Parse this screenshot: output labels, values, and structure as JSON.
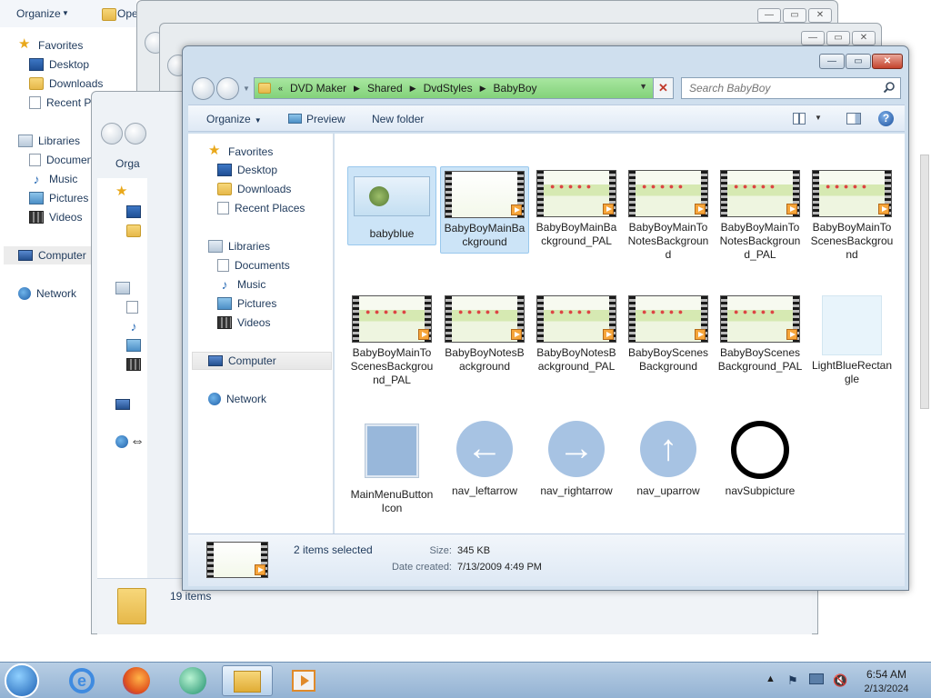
{
  "back_window": {
    "toolbar": {
      "organize": "Organize",
      "open": "Ope"
    },
    "nav": [
      {
        "label": "Favorites",
        "icon": "star-icon"
      },
      {
        "label": "Desktop",
        "icon": "desktop-icon"
      },
      {
        "label": "Downloads",
        "icon": "folder-icon"
      },
      {
        "label": "Recent Pl",
        "icon": "recent-places-icon"
      },
      {
        "label": "Libraries",
        "icon": "libraries-icon"
      },
      {
        "label": "Documen",
        "icon": "documents-icon"
      },
      {
        "label": "Music",
        "icon": "music-icon"
      },
      {
        "label": "Pictures",
        "icon": "pictures-icon"
      },
      {
        "label": "Videos",
        "icon": "videos-icon"
      },
      {
        "label": "Computer",
        "icon": "computer-icon"
      },
      {
        "label": "Network",
        "icon": "network-icon"
      }
    ],
    "middle_toolbar": {
      "organize": "Orga"
    },
    "status": "19 items"
  },
  "main_window": {
    "breadcrumbs": [
      "DVD Maker",
      "Shared",
      "DvdStyles",
      "BabyBoy"
    ],
    "search_placeholder": "Search BabyBoy",
    "toolbar": {
      "organize": "Organize",
      "preview": "Preview",
      "new_folder": "New folder"
    },
    "nav": {
      "favorites": "Favorites",
      "desktop": "Desktop",
      "downloads": "Downloads",
      "recent_places": "Recent Places",
      "libraries": "Libraries",
      "documents": "Documents",
      "music": "Music",
      "pictures": "Pictures",
      "videos": "Videos",
      "computer": "Computer",
      "network": "Network"
    },
    "files": [
      {
        "name": "babyblue",
        "kind": "image-babyblue",
        "selected": true
      },
      {
        "name": "BabyBoyMainBackground",
        "kind": "video-blank",
        "selected": true
      },
      {
        "name": "BabyBoyMainBackground_PAL",
        "kind": "video"
      },
      {
        "name": "BabyBoyMainToNotesBackground",
        "kind": "video"
      },
      {
        "name": "BabyBoyMainToNotesBackground_PAL",
        "kind": "video"
      },
      {
        "name": "BabyBoyMainToScenesBackground",
        "kind": "video"
      },
      {
        "name": "BabyBoyMainToScenesBackground_PAL",
        "kind": "video"
      },
      {
        "name": "BabyBoyNotesBackground",
        "kind": "video"
      },
      {
        "name": "BabyBoyNotesBackground_PAL",
        "kind": "video"
      },
      {
        "name": "BabyBoyScenesBackground",
        "kind": "video"
      },
      {
        "name": "BabyBoyScenesBackground_PAL",
        "kind": "video"
      },
      {
        "name": "LightBlueRectangle",
        "kind": "image-lightblue"
      },
      {
        "name": "MainMenuButtonIcon",
        "kind": "image-bluesquare"
      },
      {
        "name": "nav_leftarrow",
        "kind": "image-arrow",
        "glyph": "←"
      },
      {
        "name": "nav_rightarrow",
        "kind": "image-arrow",
        "glyph": "→"
      },
      {
        "name": "nav_uparrow",
        "kind": "image-arrow",
        "glyph": "↑"
      },
      {
        "name": "navSubpicture",
        "kind": "image-ring"
      }
    ],
    "details": {
      "selection": "2 items selected",
      "size_label": "Size:",
      "size_value": "345 KB",
      "date_label": "Date created:",
      "date_value": "7/13/2009 4:49 PM"
    }
  },
  "taskbar": {
    "apps": [
      "Internet Explorer",
      "Firefox",
      "App",
      "Windows Explorer",
      "DVD Maker"
    ],
    "time": "6:54 AM",
    "date": "2/13/2024"
  },
  "colors": {
    "address_bar": "#8fd886",
    "selection": "#cce4f7",
    "accent": "#1e395b"
  }
}
